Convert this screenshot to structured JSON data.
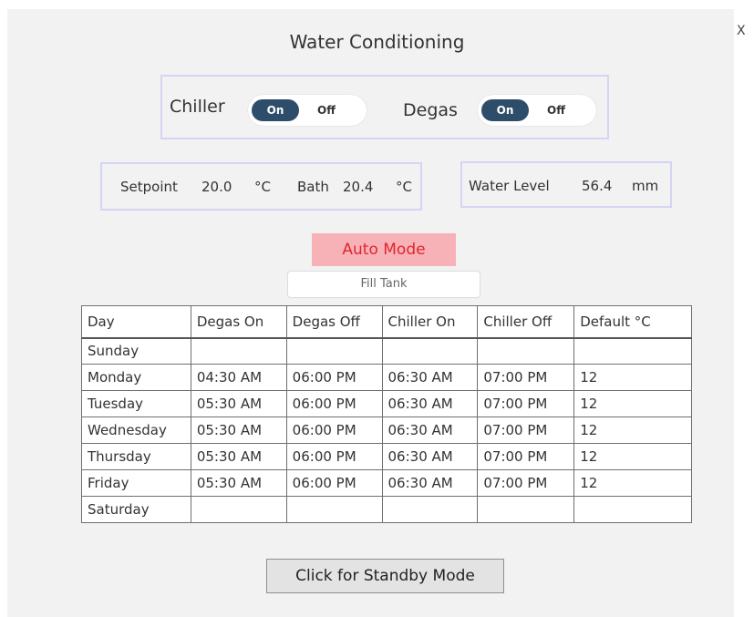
{
  "dialog": {
    "title": "Water Conditioning",
    "close_label": "X"
  },
  "chiller": {
    "label": "Chiller",
    "on_label": "On",
    "off_label": "Off",
    "state": "On"
  },
  "degas": {
    "label": "Degas",
    "on_label": "On",
    "off_label": "Off",
    "state": "On"
  },
  "readings": {
    "setpoint_label": "Setpoint",
    "setpoint_value": "20.0",
    "setpoint_unit": "°C",
    "bath_label": "Bath",
    "bath_value": "20.4",
    "bath_unit": "°C",
    "water_level_label": "Water Level",
    "water_level_value": "56.4",
    "water_level_unit": "mm"
  },
  "mode": {
    "auto_label": "Auto Mode",
    "fill_tank_label": "Fill Tank"
  },
  "schedule": {
    "columns": [
      "Day",
      "Degas On",
      "Degas Off",
      "Chiller On",
      "Chiller Off",
      "Default °C"
    ],
    "rows": [
      [
        "Sunday",
        "",
        "",
        "",
        "",
        ""
      ],
      [
        "Monday",
        "04:30 AM",
        "06:00 PM",
        "06:30 AM",
        "07:00 PM",
        "12"
      ],
      [
        "Tuesday",
        "05:30 AM",
        "06:00 PM",
        "06:30 AM",
        "07:00 PM",
        "12"
      ],
      [
        "Wednesday",
        "05:30 AM",
        "06:00 PM",
        "06:30 AM",
        "07:00 PM",
        "12"
      ],
      [
        "Thursday",
        "05:30 AM",
        "06:00 PM",
        "06:30 AM",
        "07:00 PM",
        "12"
      ],
      [
        "Friday",
        "05:30 AM",
        "06:00 PM",
        "06:30 AM",
        "07:00 PM",
        "12"
      ],
      [
        "Saturday",
        "",
        "",
        "",
        "",
        ""
      ]
    ]
  },
  "standby_button_label": "Click for Standby Mode",
  "colors": {
    "toggle_on": "#2e4d6b",
    "auto_mode_bg": "#f7b2b8",
    "auto_mode_text": "#e0252f",
    "panel_border": "#d4d4f4"
  }
}
